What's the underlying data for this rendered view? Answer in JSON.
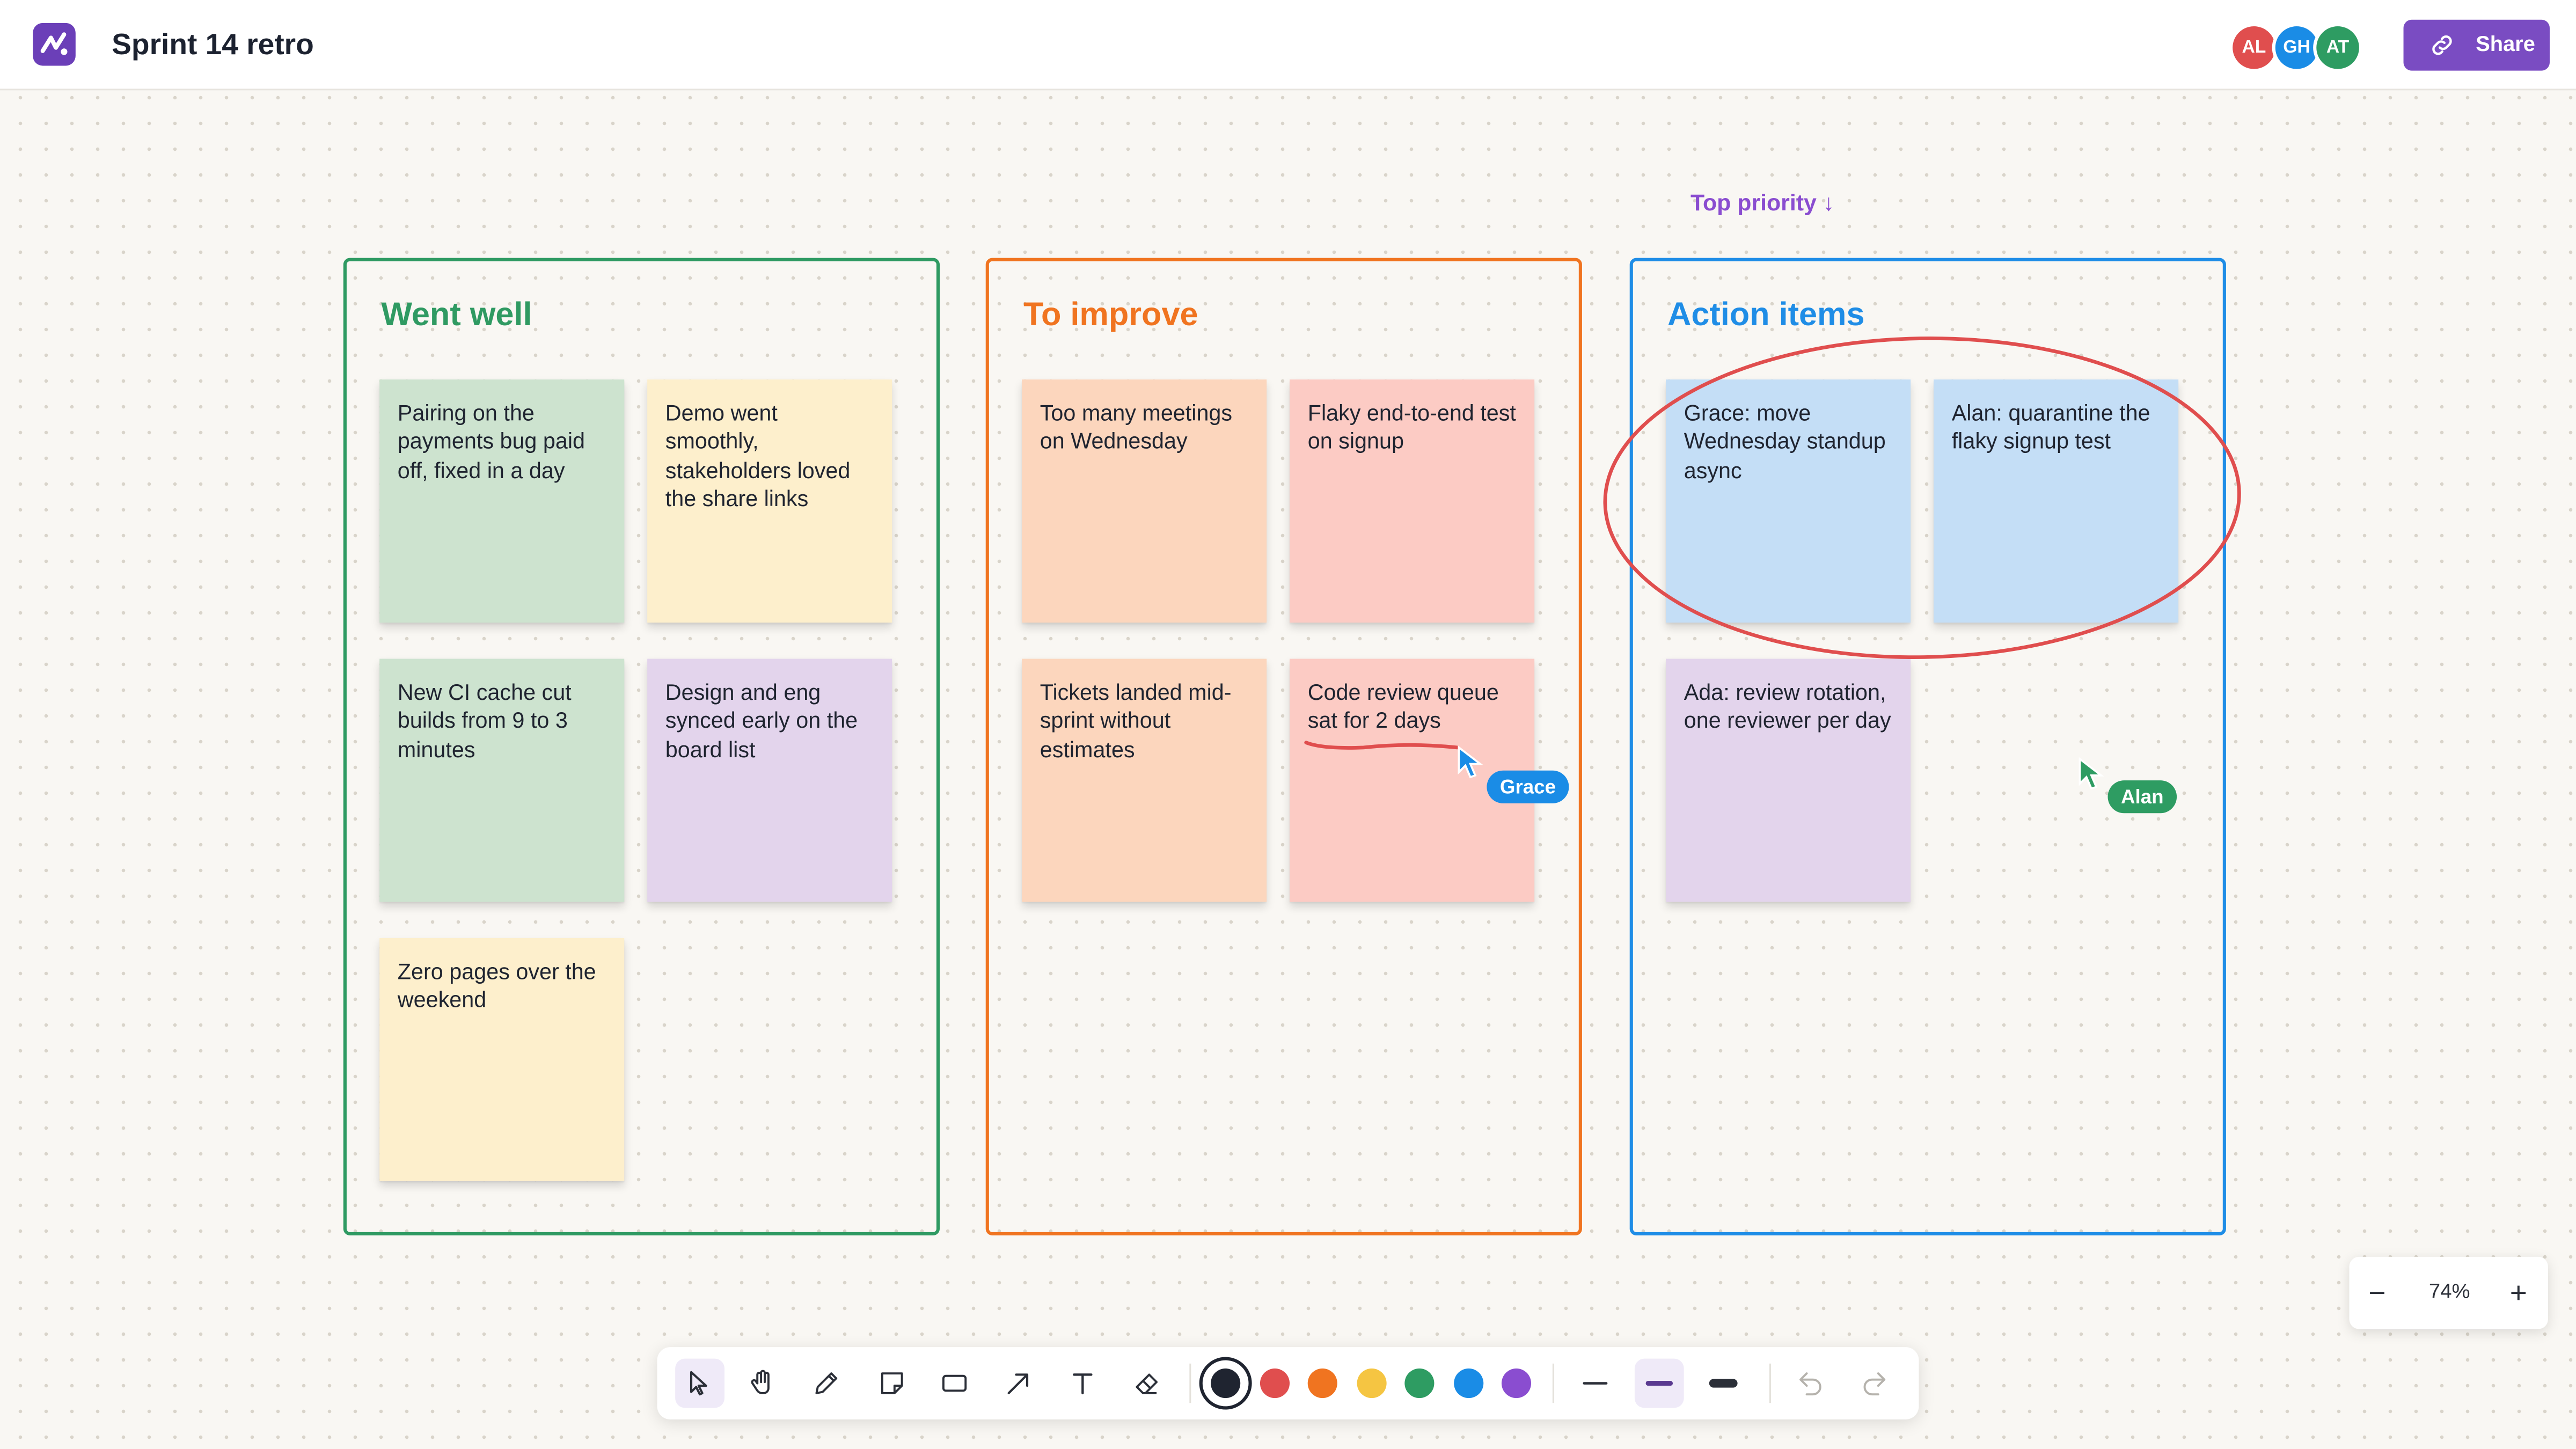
{
  "app": {
    "board_title": "Sprint 14 retro",
    "share_label": "Share",
    "collaborators": [
      {
        "initials": "AL",
        "color": "#e04e4e"
      },
      {
        "initials": "GH",
        "color": "#1a8ce6"
      },
      {
        "initials": "AT",
        "color": "#2e9c62"
      }
    ]
  },
  "annotation": {
    "text": "Top priority ↓",
    "color": "#8a4dd0"
  },
  "frames": [
    {
      "title": "Went well",
      "color": "#2f9a62",
      "notes": [
        {
          "text": "Pairing on the payments bug paid off, fixed in a day",
          "color": "#cde3cf"
        },
        {
          "text": "Demo went smoothly, stakeholders loved the share links",
          "color": "#fdefcc"
        },
        {
          "text": "New CI cache cut builds from 9 to 3 minutes",
          "color": "#cde3cf"
        },
        {
          "text": "Design and eng synced early on the board list",
          "color": "#e3d4ec"
        },
        {
          "text": "Zero pages over the weekend",
          "color": "#fdefcc"
        }
      ]
    },
    {
      "title": "To improve",
      "color": "#f07420",
      "notes": [
        {
          "text": "Too many meetings on Wednesday",
          "color": "#fcd6bd"
        },
        {
          "text": "Flaky end-to-end test on signup",
          "color": "#fccbc4"
        },
        {
          "text": "Tickets landed mid-sprint without estimates",
          "color": "#fcd6bd"
        },
        {
          "text": "Code review queue sat for 2 days",
          "color": "#fccbc4"
        }
      ]
    },
    {
      "title": "Action items",
      "color": "#1f8de6",
      "notes": [
        {
          "text": "Grace: move Wednesday standup async",
          "color": "#c4def6"
        },
        {
          "text": "Alan: quarantine the flaky signup test",
          "color": "#c4def6"
        },
        {
          "text": "Ada: review rotation, one reviewer per day",
          "color": "#e3d4ec"
        }
      ]
    }
  ],
  "cursors": [
    {
      "name": "Grace",
      "color": "#1a8ce6"
    },
    {
      "name": "Alan",
      "color": "#2e9c62"
    }
  ],
  "zoom": {
    "value": "74%",
    "minus": "−",
    "plus": "+"
  },
  "toolbar": {
    "tools": [
      "select-tool",
      "hand-tool",
      "pen-tool",
      "sticky-note-tool",
      "rectangle-tool",
      "arrow-tool",
      "text-tool",
      "eraser-tool"
    ],
    "active_tool": "select-tool",
    "colors": [
      "#1f2430",
      "#e04e4e",
      "#f07420",
      "#f5c542",
      "#2e9c62",
      "#1a8ce6",
      "#8a4dd0"
    ],
    "selected_color": "#1f2430",
    "stroke_widths": [
      "thin",
      "medium",
      "thick"
    ],
    "selected_stroke": "medium"
  }
}
